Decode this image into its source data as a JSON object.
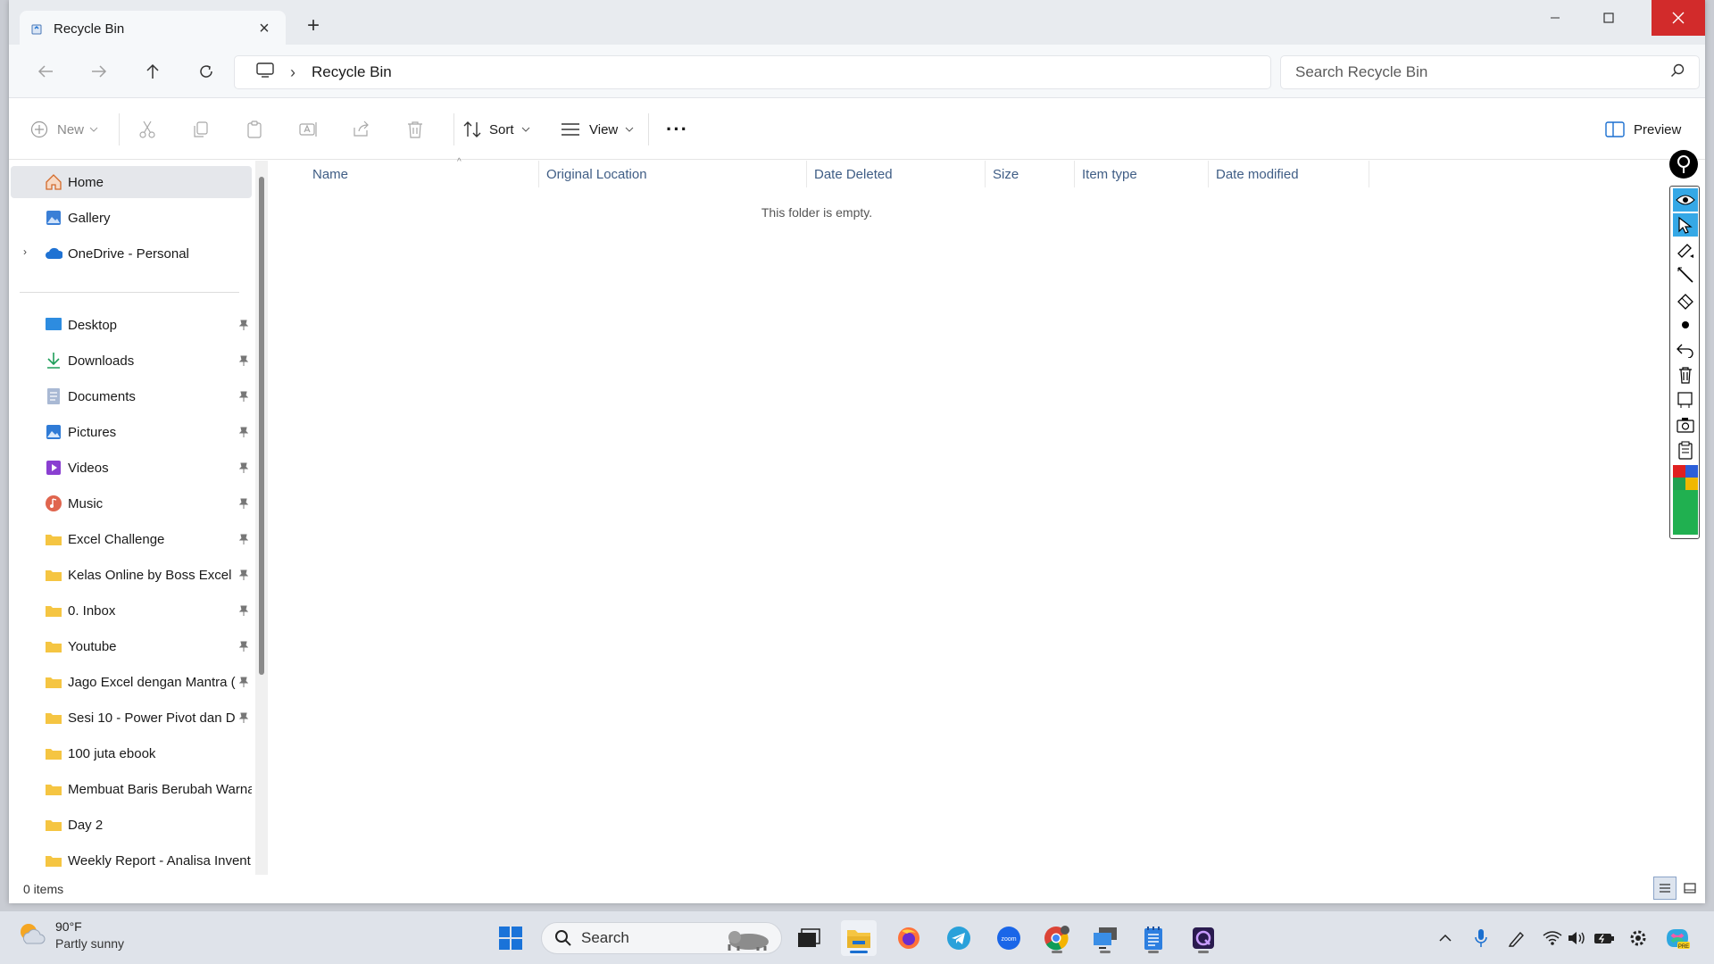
{
  "window": {
    "tab_title": "Recycle Bin",
    "new_tab_glyph": "+",
    "close_tab_glyph": "×"
  },
  "navigation": {
    "breadcrumb_separator": "›",
    "address": "Recycle Bin",
    "search_placeholder": "Search Recycle Bin"
  },
  "toolbar": {
    "new_label": "New",
    "sort_label": "Sort",
    "view_label": "View",
    "more_label": "···",
    "preview_label": "Preview"
  },
  "sidebar": {
    "top_items": [
      {
        "label": "Home",
        "icon": "home-icon"
      },
      {
        "label": "Gallery",
        "icon": "gallery-icon"
      },
      {
        "label": "OneDrive - Personal",
        "icon": "cloud-icon"
      }
    ],
    "pinned_items": [
      {
        "label": "Desktop",
        "icon": "desktop-icon"
      },
      {
        "label": "Downloads",
        "icon": "download-icon"
      },
      {
        "label": "Documents",
        "icon": "documents-icon"
      },
      {
        "label": "Pictures",
        "icon": "pictures-icon"
      },
      {
        "label": "Videos",
        "icon": "videos-icon"
      },
      {
        "label": "Music",
        "icon": "music-icon"
      },
      {
        "label": "Excel Challenge",
        "icon": "folder-icon"
      },
      {
        "label": "Kelas Online by Boss Excel",
        "icon": "folder-icon"
      },
      {
        "label": "0. Inbox",
        "icon": "folder-icon"
      },
      {
        "label": "Youtube",
        "icon": "folder-icon"
      },
      {
        "label": "Jago Excel dengan Mantra (",
        "icon": "folder-icon"
      },
      {
        "label": "Sesi 10 - Power Pivot dan D",
        "icon": "folder-icon"
      },
      {
        "label": "100 juta ebook",
        "icon": "folder-icon"
      },
      {
        "label": "Membuat Baris Berubah Warna",
        "icon": "folder-icon"
      },
      {
        "label": "Day 2",
        "icon": "folder-icon"
      },
      {
        "label": "Weekly Report - Analisa Invent",
        "icon": "folder-icon"
      }
    ]
  },
  "columns": [
    "Name",
    "Original Location",
    "Date Deleted",
    "Size",
    "Item type",
    "Date modified"
  ],
  "content": {
    "empty_message": "This folder is empty."
  },
  "status": {
    "item_count": "0 items"
  },
  "taskbar": {
    "weather_temp": "90°F",
    "weather_desc": "Partly sunny",
    "search_label": "Search"
  },
  "colors": {
    "accent": "#1a6fd0",
    "close_red": "#d22b2b",
    "folder_yellow": "#f5c542",
    "column_header": "#3f5d85"
  }
}
